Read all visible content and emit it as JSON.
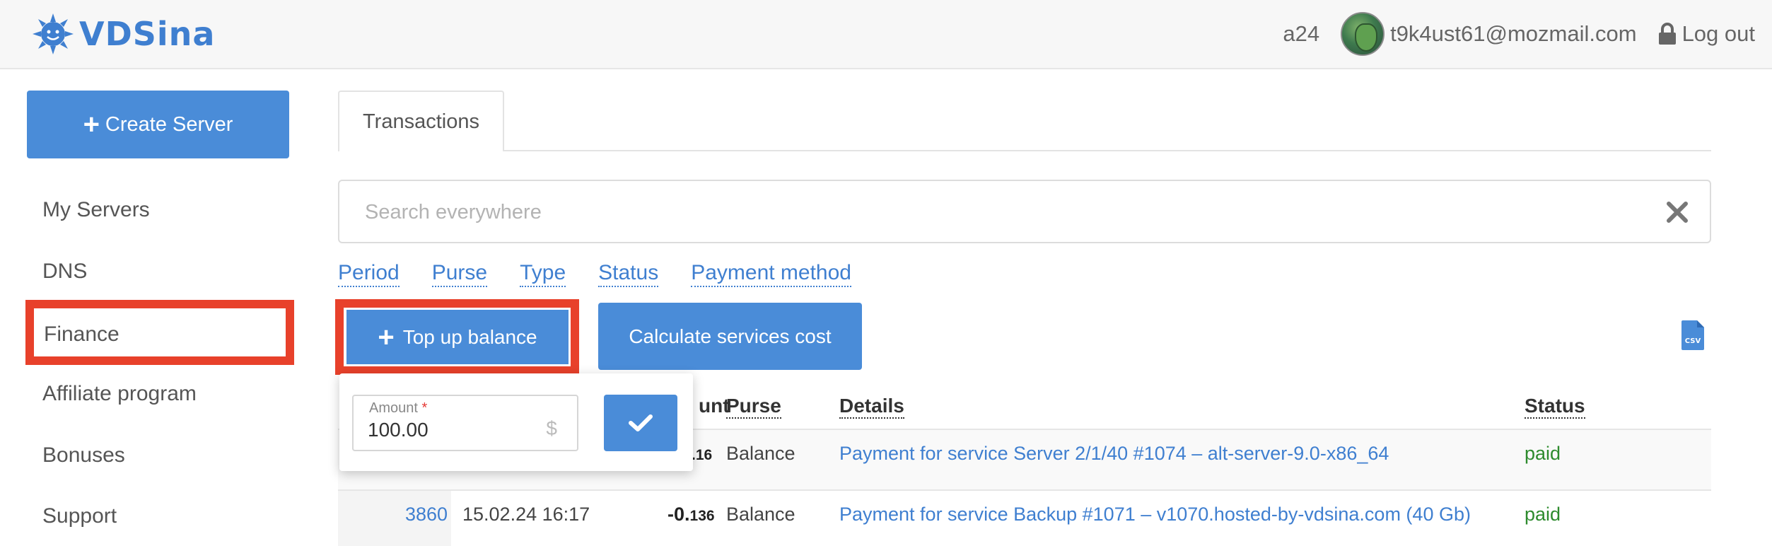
{
  "header": {
    "logo_text": "VDSina",
    "account_id": "a24",
    "email": "t9k4ust61@mozmail.com",
    "logout_label": "Log out"
  },
  "sidebar": {
    "create_label": "Create Server",
    "items": [
      {
        "label": "My Servers"
      },
      {
        "label": "DNS"
      },
      {
        "label": "Finance"
      },
      {
        "label": "Affiliate program"
      },
      {
        "label": "Bonuses"
      },
      {
        "label": "Support"
      }
    ]
  },
  "main": {
    "tab_label": "Transactions",
    "search_placeholder": "Search everywhere",
    "filters": [
      "Period",
      "Purse",
      "Type",
      "Status",
      "Payment method"
    ],
    "topup_label": "Top up balance",
    "calc_label": "Calculate services cost",
    "export_icon": "csv-icon"
  },
  "popover": {
    "amount_label": "Amount",
    "required_mark": "*",
    "amount_value": "100.00",
    "currency": "$"
  },
  "table": {
    "headers": {
      "amount_partial": "unt",
      "purse": "Purse",
      "details": "Details",
      "status": "Status"
    },
    "rows": [
      {
        "id": "",
        "date": "",
        "amount_main": "",
        "amount_small": ".16",
        "purse": "Balance",
        "details": "Payment for service Server 2/1/40 #1074 – alt-server-9.0-x86_64",
        "status": "paid"
      },
      {
        "id": "3860",
        "date": "15.02.24 16:17",
        "amount_main": "-0.",
        "amount_small": "136",
        "purse": "Balance",
        "details": "Payment for service Backup #1071 – v1070.hosted-by-vdsina.com (40 Gb)",
        "status": "paid"
      }
    ]
  },
  "colors": {
    "accent": "#4a8cd8",
    "highlight": "#e8412b",
    "paid": "#2e8b2e"
  }
}
